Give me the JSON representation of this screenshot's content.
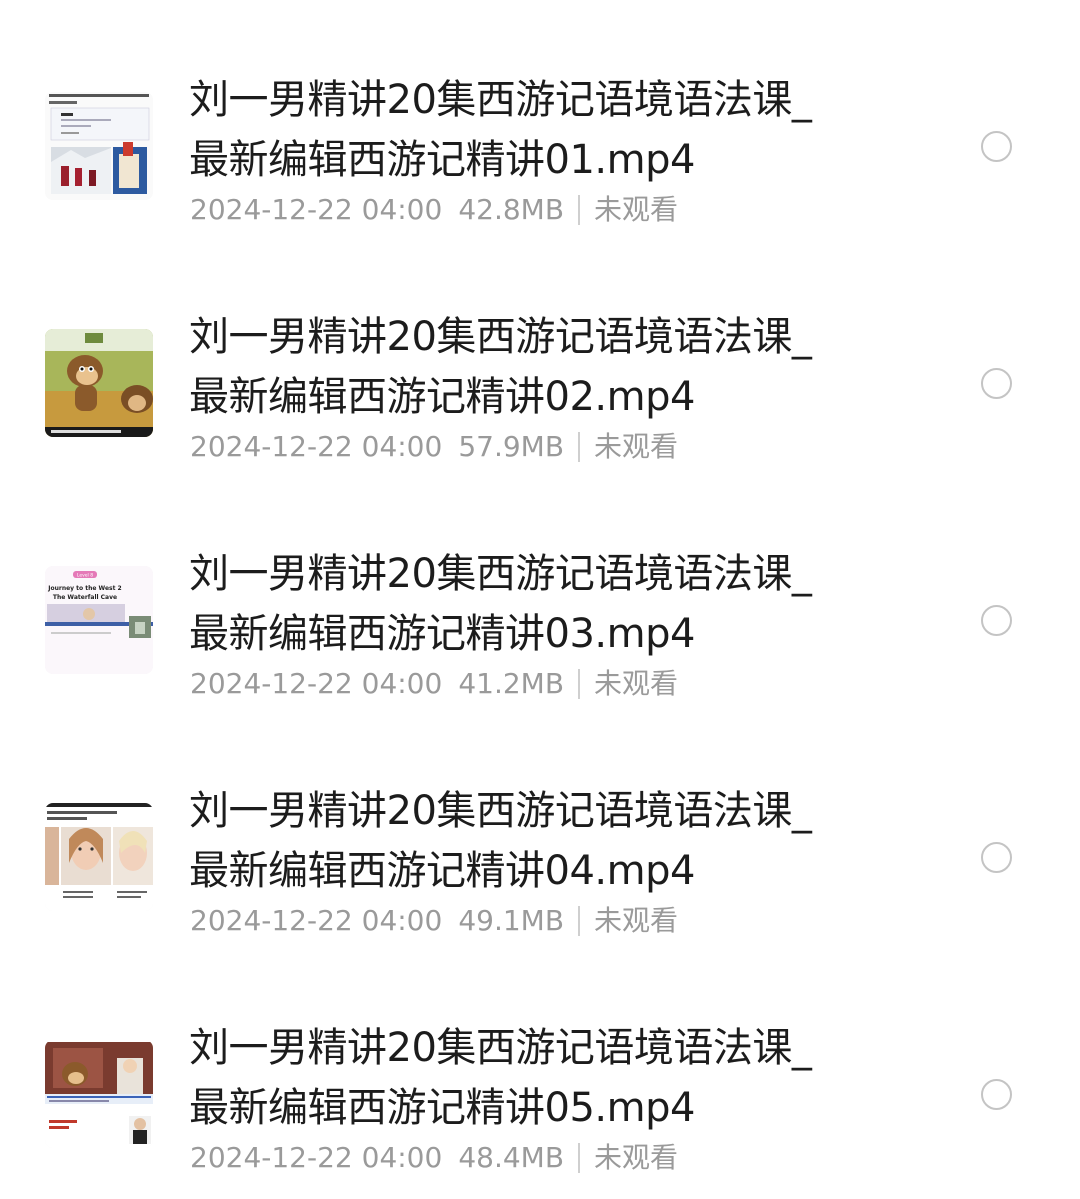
{
  "files": [
    {
      "title_line1": "刘一男精讲20集西游记语境语法课_",
      "title_line2": "最新编辑西游记精讲01.mp4",
      "date": "2024-12-22 04:00",
      "size": "42.8MB",
      "status": "未观看",
      "thumbnail_icon": "video-thumbnail-slide"
    },
    {
      "title_line1": "刘一男精讲20集西游记语境语法课_",
      "title_line2": "最新编辑西游记精讲02.mp4",
      "date": "2024-12-22 04:00",
      "size": "57.9MB",
      "status": "未观看",
      "thumbnail_icon": "video-thumbnail-cartoon-monkey"
    },
    {
      "title_line1": "刘一男精讲20集西游记语境语法课_",
      "title_line2": "最新编辑西游记精讲03.mp4",
      "date": "2024-12-22 04:00",
      "size": "41.2MB",
      "status": "未观看",
      "thumbnail_icon": "video-thumbnail-title-slide",
      "thumbnail_text": {
        "tag": "Level 8",
        "line1": "Journey to the West 2",
        "line2": "The Waterfall Cave"
      }
    },
    {
      "title_line1": "刘一男精讲20集西游记语境语法课_",
      "title_line2": "最新编辑西游记精讲04.mp4",
      "date": "2024-12-22 04:00",
      "size": "49.1MB",
      "status": "未观看",
      "thumbnail_icon": "video-thumbnail-faces"
    },
    {
      "title_line1": "刘一男精讲20集西游记语境语法课_",
      "title_line2": "最新编辑西游记精讲05.mp4",
      "date": "2024-12-22 04:00",
      "size": "48.4MB",
      "status": "未观看",
      "thumbnail_icon": "video-thumbnail-cartoon-scene"
    }
  ],
  "colors": {
    "title": "#1c1c1c",
    "meta": "#9a9a9a",
    "radio_border": "#c4c4c4"
  }
}
